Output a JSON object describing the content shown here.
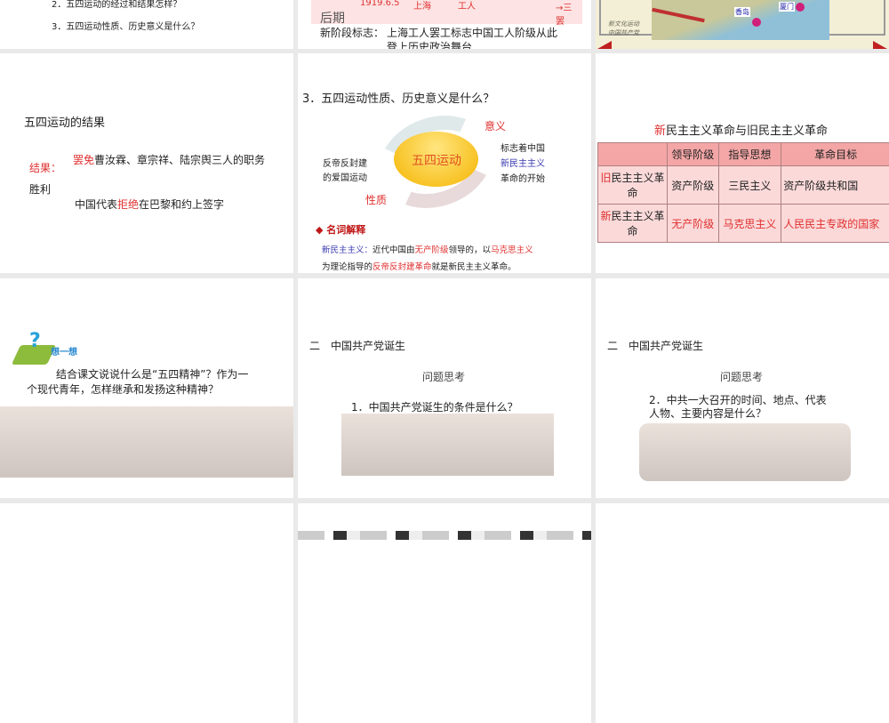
{
  "slides": [
    {
      "q2": "2．五四运动的经过和结果怎样？",
      "q3": "3．五四运动性质、历史意义是什么？"
    },
    {
      "date": "1919.6.5",
      "place": "上海",
      "class": "工人",
      "arrow": "→三罢",
      "period": "后期",
      "mark_label": "新阶段标志：",
      "mark_text1": "上海工人罢工标志中国工人阶级从此",
      "mark_text2": "登上历史政治舞台"
    },
    {
      "city1": "香岛",
      "city2": "厦门",
      "legend1": "新文化运动",
      "legend2": "中国共产党"
    },
    {
      "title": "五四运动的结果",
      "result_label": "结果：",
      "win": "胜利",
      "line1_red": "罢免",
      "line1": "曹汝霖、章宗祥、陆宗舆三人的职务",
      "line2_a": "中国代表",
      "line2_red": "拒绝",
      "line2_b": "在巴黎和约上签字"
    },
    {
      "title": "3．五四运动性质、历史意义是什么？",
      "center": "五四运动",
      "meaning": "意义",
      "nature": "性质",
      "left1": "反帝反封建",
      "left2": "的爱国运动",
      "right1": "标志着中国",
      "right2": "新民主主义",
      "right3": "革命的开始",
      "term_head": "名词解释",
      "def_term": "新民主主义：",
      "def1": "近代中国由",
      "def_red1": "无产阶级",
      "def2": "领导的，以",
      "def_red2": "马克思主义",
      "def3": "为理论指导的",
      "def_red3": "反帝反封建革命",
      "def4": "就是新民主主义革命。"
    },
    {
      "title_red": "新",
      "title": "民主主义革命与旧民主主义革命",
      "headers": [
        "",
        "领导阶级",
        "指导思想",
        "革命目标"
      ],
      "row_old": {
        "red": "旧",
        "label": "民主主义革命",
        "c1": "资产阶级",
        "c2": "三民主义",
        "c3": "资产阶级共和国"
      },
      "row_new": {
        "red": "新",
        "label": "民主主义革命",
        "c1": "无产阶级",
        "c2": "马克思主义",
        "c3": "人民民主专政的国家"
      }
    },
    {
      "think": "想一想",
      "text1": "结合课文说说什么是“五四精神”？作为一",
      "text2": "个现代青年，怎样继承和发扬这种精神？"
    },
    {
      "section": "二　中国共产党诞生",
      "sub": "问题思考",
      "q": "1．中国共产党诞生的条件是什么？"
    },
    {
      "section": "二　中国共产党诞生",
      "sub": "问题思考",
      "q1": "2．中共一大召开的时间、地点、代表",
      "q2": "人物、主要内容是什么？"
    }
  ],
  "colors": {
    "accent_red": "#e03030",
    "table_head": "#f4a6a6",
    "table_body": "#fbd9d9"
  }
}
